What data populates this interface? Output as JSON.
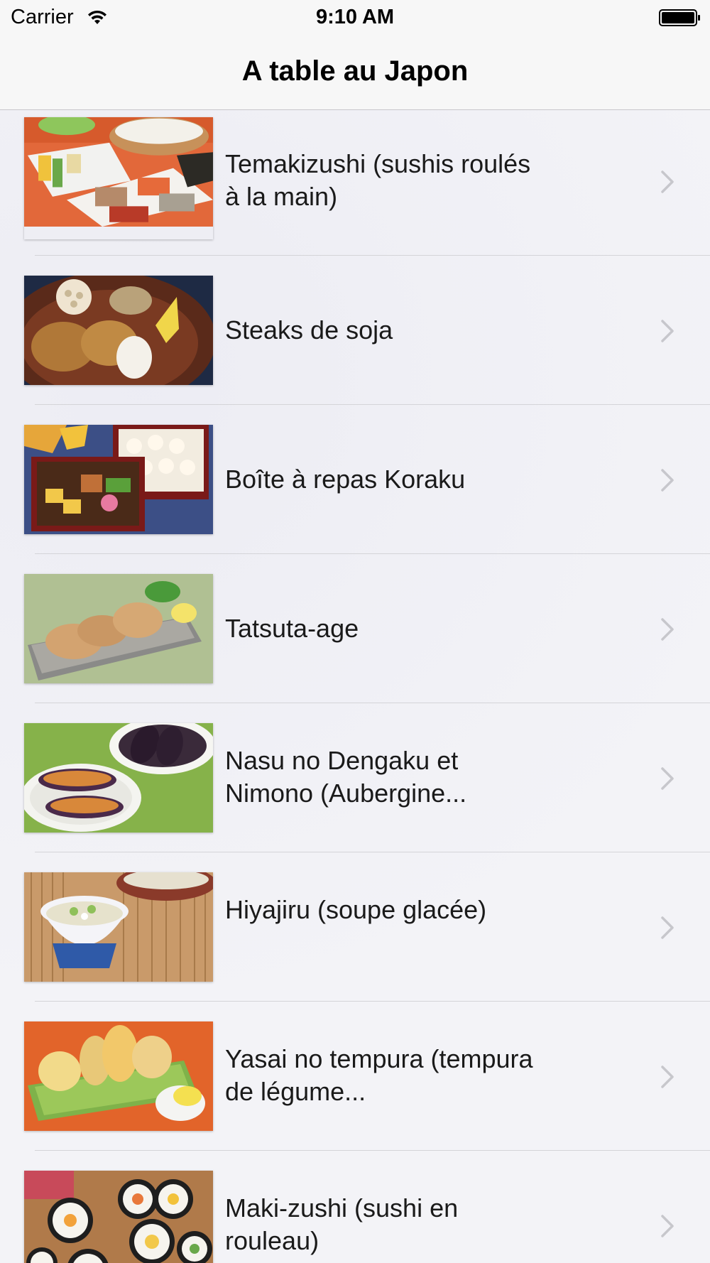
{
  "status_bar": {
    "carrier": "Carrier",
    "time": "9:10 AM"
  },
  "nav": {
    "title": "A table au Japon"
  },
  "items": [
    {
      "label": "Temakizushi (sushis roulés à la main)"
    },
    {
      "label": "Steaks de soja"
    },
    {
      "label": "Boîte à repas Koraku"
    },
    {
      "label": "Tatsuta-age"
    },
    {
      "label": "Nasu no Dengaku et Nimono (Aubergine..."
    },
    {
      "label": "Hiyajiru (soupe glacée)"
    },
    {
      "label": "Yasai no tempura (tempura de légume..."
    },
    {
      "label": "Maki-zushi (sushi en rouleau)"
    }
  ],
  "colors": {
    "background": "#f3f3f7",
    "separator": "#d4d4d8",
    "chevron": "#c7c7cc"
  }
}
